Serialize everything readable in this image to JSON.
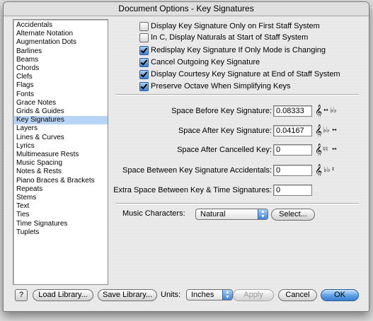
{
  "window": {
    "title": "Document Options - Key Signatures"
  },
  "sidebar": {
    "items": [
      "Accidentals",
      "Alternate Notation",
      "Augmentation Dots",
      "Barlines",
      "Beams",
      "Chords",
      "Clefs",
      "Flags",
      "Fonts",
      "Grace Notes",
      "Grids & Guides",
      "Key Signatures",
      "Layers",
      "Lines & Curves",
      "Lyrics",
      "Multimeasure Rests",
      "Music Spacing",
      "Notes & Rests",
      "Piano Braces & Brackets",
      "Repeats",
      "Stems",
      "Text",
      "Ties",
      "Time Signatures",
      "Tuplets"
    ],
    "selected": "Key Signatures"
  },
  "options": [
    {
      "label": "Display Key Signature Only on First Staff System",
      "checked": false
    },
    {
      "label": "In C, Display Naturals at Start of Staff System",
      "checked": false
    },
    {
      "label": "Redisplay Key Signature If Only Mode is Changing",
      "checked": true
    },
    {
      "label": "Cancel Outgoing Key Signature",
      "checked": true
    },
    {
      "label": "Display Courtesy Key Signature at End of Staff System",
      "checked": true
    },
    {
      "label": "Preserve Octave When Simplifying Keys",
      "checked": true
    }
  ],
  "spacing": [
    {
      "label": "Space Before Key Signature:",
      "value": "0.08333",
      "example": "treble-clef-arrow-flats-icon"
    },
    {
      "label": "Space After Key Signature:",
      "value": "0.04167",
      "example": "treble-clef-flats-arrow-icon"
    },
    {
      "label": "Space After Cancelled Key:",
      "value": "0",
      "example": "treble-clef-naturals-arrow-icon"
    },
    {
      "label": "Space Between Key Signature Accidentals:",
      "value": "0",
      "example": "treble-clef-flats-spacing-icon"
    },
    {
      "label": "Extra Space Between Key & Time Signatures:",
      "value": "0"
    }
  ],
  "music_characters": {
    "label": "Music Characters:",
    "value": "Natural",
    "button": "Select..."
  },
  "footer": {
    "help": "?",
    "load_library": "Load Library...",
    "save_library": "Save Library...",
    "units_label": "Units:",
    "units_value": "Inches",
    "apply": "Apply",
    "cancel": "Cancel",
    "ok": "OK"
  },
  "colors": {
    "selection": "#b7d4f7",
    "accent": "#3d82d6"
  }
}
